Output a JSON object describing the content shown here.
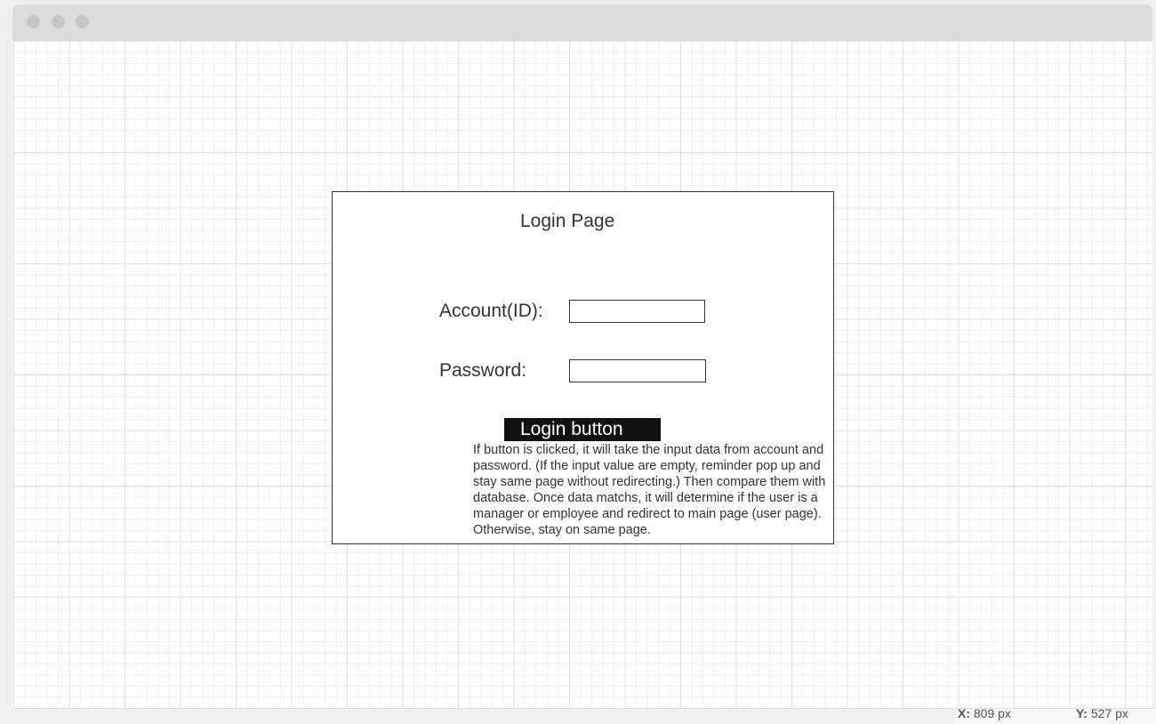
{
  "window": {
    "controls": [
      "close",
      "minimize",
      "maximize"
    ]
  },
  "login_page": {
    "title": "Login Page",
    "account_label": "Account(ID):",
    "account_value": "",
    "password_label": "Password:",
    "password_value": "",
    "login_button_label": "Login button",
    "note": "If button is clicked, it will take the input data from account and password. (If the input value are empty, reminder pop up and stay same page without redirecting.) Then compare them with database. Once data matchs, it will determine if the user is a manager or employee and redirect to main page (user page). Otherwise, stay on same page."
  },
  "status_bar": {
    "x_label": "X:",
    "x_value": "809 px",
    "y_label": "Y:",
    "y_value": "527 px"
  }
}
